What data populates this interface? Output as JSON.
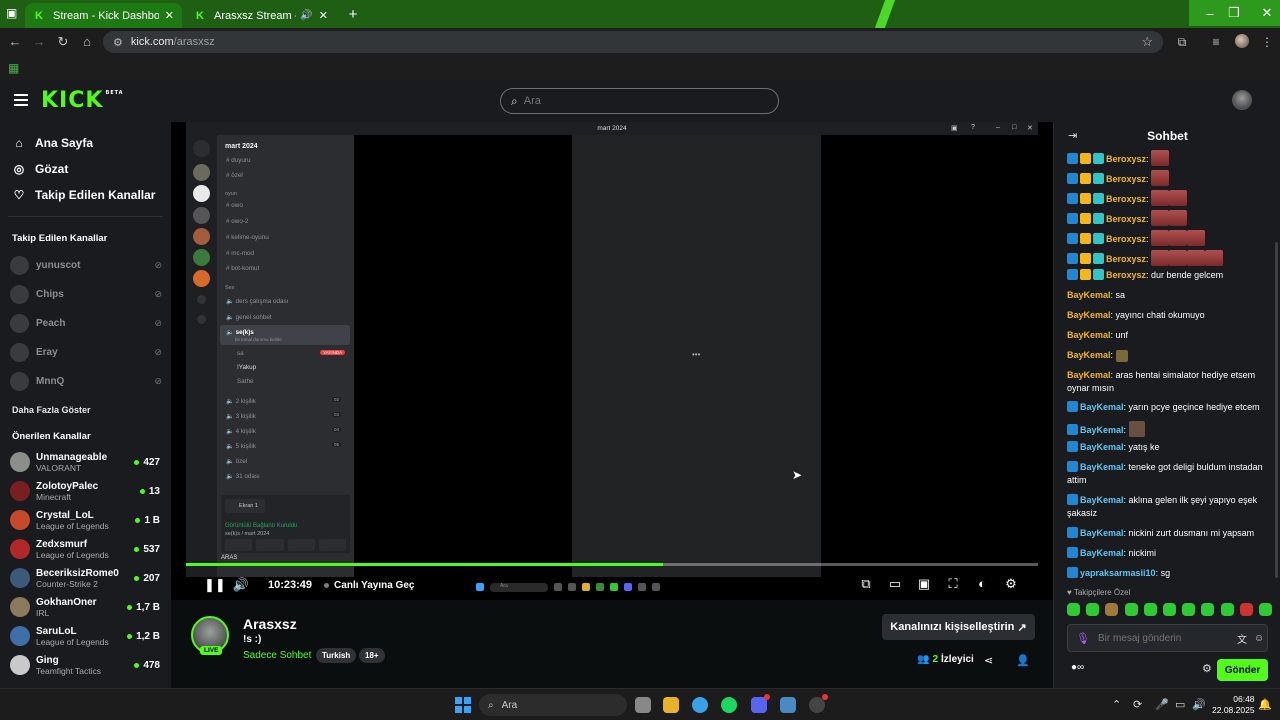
{
  "browser": {
    "tabs": [
      {
        "title": "Stream - Kick Dashboard",
        "active": true
      },
      {
        "title": "Arasxsz Stream - Watch Live",
        "active": false
      }
    ],
    "url_host": "kick.com",
    "url_path": "/arasxsz",
    "accent": "#53fc18"
  },
  "kick": {
    "logo": "KICK",
    "logo_badge": "BETA",
    "search_placeholder": "Ara"
  },
  "sidebar": {
    "nav": [
      {
        "label": "Ana Sayfa",
        "icon": "home-icon"
      },
      {
        "label": "Gözat",
        "icon": "compass-icon"
      },
      {
        "label": "Takip Edilen Kanallar",
        "icon": "heart-icon"
      }
    ],
    "followed_header": "Takip Edilen Kanallar",
    "followed": [
      "yunuscot",
      "Chips",
      "Peach",
      "Eray",
      "MnnQ"
    ],
    "show_more": "Daha Fazla Göster",
    "recommended_header": "Önerilen Kanallar",
    "recommended": [
      {
        "name": "Unmanageable",
        "category": "VALORANT",
        "viewers": "427"
      },
      {
        "name": "ZolotoyPalec",
        "category": "Minecraft",
        "viewers": "13"
      },
      {
        "name": "Crystal_LoL",
        "category": "League of Legends",
        "viewers": "1 B"
      },
      {
        "name": "Zedxsmurf",
        "category": "League of Legends",
        "viewers": "537"
      },
      {
        "name": "BeceriksizRome0",
        "category": "Counter-Strike 2",
        "viewers": "207"
      },
      {
        "name": "GokhanOner",
        "category": "IRL",
        "viewers": "1,7 B"
      },
      {
        "name": "SaruLoL",
        "category": "League of Legends",
        "viewers": "1,2 B"
      },
      {
        "name": "Ging",
        "category": "Teamfight Tactics",
        "viewers": "478"
      }
    ]
  },
  "video": {
    "window_title": "mart 2024",
    "discord": {
      "server": "mart 2024",
      "channels": [
        "duyuru",
        "özel",
        "owo",
        "owo-2",
        "kelime-oyunu",
        "mc-mod",
        "bot-komut"
      ],
      "cat_text": "oyun",
      "cat_voice": "Ses",
      "voice_channels": [
        "ders çalışma odası",
        "genel sohbet",
        "se(k)s"
      ],
      "voice_sub": "bir kanal durumu belirle",
      "voice_users": [
        "sa",
        "!Yakup",
        "Sathe"
      ],
      "live_label": "YAYINDA",
      "more_voice": [
        "2 kişilik",
        "3 kişilik",
        "4 kişilik",
        "5 kişilik",
        "özel",
        "31 odası"
      ],
      "pill_counts": [
        "02",
        "03",
        "04",
        "05"
      ],
      "screen_label": "Ekran 1",
      "connected": "Görüntülü Bağlantı Kuruldu",
      "connected_sub": "se(k)s / mart 2024",
      "user": "ARAS"
    },
    "progress": 0.56,
    "time": "10:23:49",
    "go_live": "Canlı Yayına Geç",
    "mini_search": "Ara"
  },
  "channel": {
    "name": "Arasxsz",
    "live_label": "LIVE",
    "title": "!s :)",
    "category": "Sadece Sohbet",
    "tags": [
      "Turkish",
      "18+"
    ],
    "customize_label": "Kanalınızı kişiselleştirin",
    "viewer_count": "2",
    "viewer_label": "İzleyici"
  },
  "chat": {
    "title": "Sohbet",
    "messages": [
      {
        "user": "Beroxysz",
        "text": "",
        "badges": 3,
        "color": "#f2b71f",
        "emotes": 1
      },
      {
        "user": "Beroxysz",
        "text": "",
        "badges": 3,
        "color": "#f2b71f",
        "emotes": 1
      },
      {
        "user": "Beroxysz",
        "text": "",
        "badges": 3,
        "color": "#f2b71f",
        "emotes": 2
      },
      {
        "user": "Beroxysz",
        "text": "",
        "badges": 3,
        "color": "#f2b71f",
        "emotes": 2
      },
      {
        "user": "Beroxysz",
        "text": "",
        "badges": 3,
        "color": "#f2b71f",
        "emotes": 3
      },
      {
        "user": "Beroxysz",
        "text": "",
        "badges": 3,
        "color": "#f2b71f",
        "emotes": 4
      },
      {
        "user": "Beroxysz",
        "text": "dur bende gelcem",
        "badges": 3,
        "color": "#f2b71f",
        "emotes": 0
      },
      {
        "user": "BayKemal",
        "text": "sa",
        "badges": 0,
        "color": "#f2b71f",
        "emotes": 0
      },
      {
        "user": "BayKemal",
        "text": "yayıncı chati okumuyo",
        "badges": 0,
        "color": "#f2b71f",
        "emotes": 0
      },
      {
        "user": "BayKemal",
        "text": "unf",
        "badges": 0,
        "color": "#f2b71f",
        "emotes": 0
      },
      {
        "user": "BayKemal",
        "text": "",
        "badges": 0,
        "color": "#f2b71f",
        "emotes": 1
      },
      {
        "user": "BayKemal",
        "text": "aras hentai simalator hediye etsem oynar mısın",
        "badges": 0,
        "color": "#f2b71f",
        "emotes": 0
      },
      {
        "user": "BayKemal",
        "text": "yarın pcye geçince hediye etcem",
        "badges": 1,
        "color": "#5bc8f5",
        "emotes": 0
      },
      {
        "user": "BayKemal",
        "text": "",
        "badges": 1,
        "color": "#5bc8f5",
        "emotes": 1
      },
      {
        "user": "BayKemal",
        "text": "yatış ke",
        "badges": 1,
        "color": "#5bc8f5",
        "emotes": 0
      },
      {
        "user": "BayKemal",
        "text": "teneke got deligi buldum instadan attim",
        "badges": 1,
        "color": "#5bc8f5",
        "emotes": 0
      },
      {
        "user": "BayKemal",
        "text": "aklına gelen ilk şeyi yapıyo eşek şakasiz",
        "badges": 1,
        "color": "#5bc8f5",
        "emotes": 0
      },
      {
        "user": "BayKemal",
        "text": "nickini zurt dusmanı mi yapsam",
        "badges": 1,
        "color": "#5bc8f5",
        "emotes": 0
      },
      {
        "user": "BayKemal",
        "text": "nickimi",
        "badges": 1,
        "color": "#5bc8f5",
        "emotes": 0
      },
      {
        "user": "yapraksarmasii10",
        "text": "sg",
        "badges": 1,
        "color": "#5bc8f5",
        "emotes": 0
      }
    ],
    "pinned_label": "Takipçilere Özel",
    "input_placeholder": "Bir mesaj gönderin",
    "send_label": "Gönder"
  },
  "taskbar": {
    "search": "Ara",
    "time": "06:48",
    "date": "22.08.2025"
  }
}
